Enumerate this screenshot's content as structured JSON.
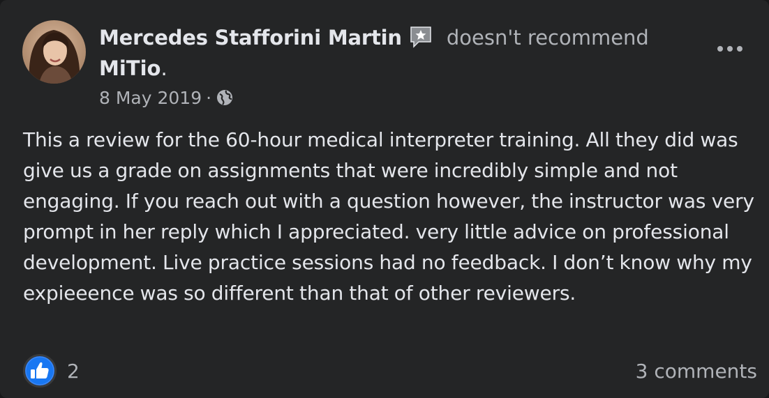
{
  "post": {
    "author": "Mercedes Stafforini Martin",
    "verb": "doesn't recommend",
    "page_name": "MiTio",
    "page_suffix": ".",
    "date": "8 May 2019",
    "separator": "·",
    "audience_icon": "globe-icon",
    "badge_icon": "review-star-badge-icon",
    "more_icon": "more-horizontal-icon",
    "body": "This a review for the 60-hour medical interpreter training. All they did was give us a grade on assignments that were incredibly simple and not engaging. If you reach out with a question however, the instructor was very prompt in her reply which I appreciated. very little advice on professional development. Live practice sessions had no feedback. I don’t know why my expieeence was so different than that of other reviewers."
  },
  "footer": {
    "like_count": "2",
    "comments": "3 comments",
    "like_icon": "thumbs-up-icon"
  },
  "colors": {
    "background": "#242526",
    "primary_text": "#e4e6eb",
    "secondary_text": "#b0b3b8",
    "like_blue": "#1877f2"
  }
}
